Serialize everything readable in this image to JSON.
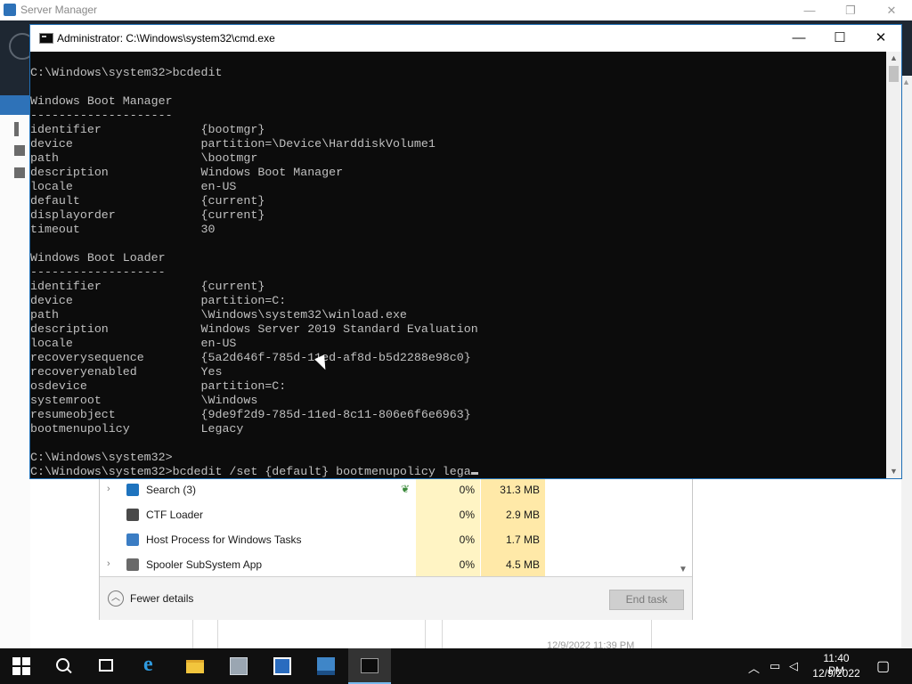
{
  "server_manager": {
    "title": "Server Manager",
    "controls": {
      "minimize": "—",
      "restore": "❐",
      "close": "✕"
    },
    "tile_timestamp": "12/9/2022 11:39 PM"
  },
  "cmd": {
    "title": "Administrator: C:\\Windows\\system32\\cmd.exe",
    "controls": {
      "minimize": "—",
      "maximize": "☐",
      "close": "✕"
    },
    "lines": [
      "C:\\Windows\\system32>bcdedit",
      "",
      "Windows Boot Manager",
      "--------------------",
      "identifier              {bootmgr}",
      "device                  partition=\\Device\\HarddiskVolume1",
      "path                    \\bootmgr",
      "description             Windows Boot Manager",
      "locale                  en-US",
      "default                 {current}",
      "displayorder            {current}",
      "timeout                 30",
      "",
      "Windows Boot Loader",
      "-------------------",
      "identifier              {current}",
      "device                  partition=C:",
      "path                    \\Windows\\system32\\winload.exe",
      "description             Windows Server 2019 Standard Evaluation",
      "locale                  en-US",
      "recoverysequence        {5a2d646f-785d-11ed-af8d-b5d2288e98c0}",
      "recoveryenabled         Yes",
      "osdevice                partition=C:",
      "systemroot              \\Windows",
      "resumeobject            {9de9f2d9-785d-11ed-8c11-806e6f6e6963}",
      "bootmenupolicy          Legacy",
      "",
      "C:\\Windows\\system32>"
    ],
    "current_input": "C:\\Windows\\system32>bcdedit /set {default} bootmenupolicy lega"
  },
  "task_manager": {
    "processes": [
      {
        "name": "Search (3)",
        "expandable": true,
        "icon": "search-process-icon",
        "icon_color": "#1e73be",
        "suspended_leaf": true,
        "cpu": "0%",
        "memory": "31.3 MB"
      },
      {
        "name": "CTF Loader",
        "expandable": false,
        "icon": "ctf-loader-icon",
        "icon_color": "#4a4a4a",
        "suspended_leaf": false,
        "cpu": "0%",
        "memory": "2.9 MB"
      },
      {
        "name": "Host Process for Windows Tasks",
        "expandable": false,
        "icon": "host-process-icon",
        "icon_color": "#3b7dc4",
        "suspended_leaf": false,
        "cpu": "0%",
        "memory": "1.7 MB"
      },
      {
        "name": "Spooler SubSystem App",
        "expandable": true,
        "icon": "printer-icon",
        "icon_color": "#6a6a6a",
        "suspended_leaf": false,
        "cpu": "0%",
        "memory": "4.5 MB"
      }
    ],
    "fewer_details": "Fewer details",
    "end_task": "End task",
    "expand_glyph": "›",
    "leaf_glyph": "❦"
  },
  "taskbar": {
    "time": "11:40 PM",
    "date": "12/9/2022",
    "icons": [
      "start-icon",
      "search-icon",
      "task-view-icon",
      "internet-explorer-icon",
      "file-explorer-icon",
      "server-manager-icon",
      "powershell-icon",
      "task-manager-icon",
      "cmd-icon"
    ],
    "tray_icons": [
      "show-hidden-icons-chevron",
      "network-icon",
      "volume-icon",
      "notifications-icon"
    ]
  },
  "colors": {
    "cmd_background": "#0c0c0c",
    "cmd_text": "#c0c0c0",
    "accent_blue": "#1f6fb6",
    "taskbar": "#101010",
    "cpu_heat": "#fff4c4",
    "memory_heat": "#ffe9a8"
  }
}
